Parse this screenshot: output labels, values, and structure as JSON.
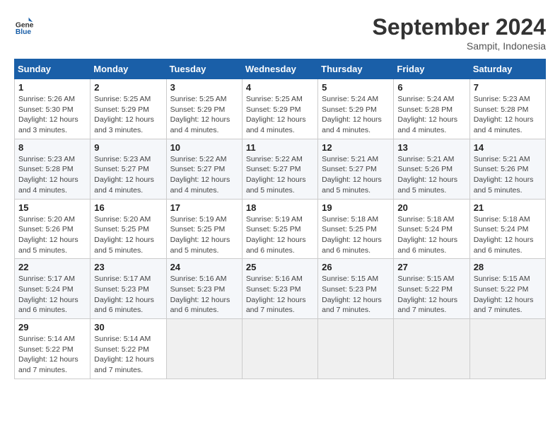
{
  "header": {
    "logo_general": "General",
    "logo_blue": "Blue",
    "month_title": "September 2024",
    "location": "Sampit, Indonesia"
  },
  "weekdays": [
    "Sunday",
    "Monday",
    "Tuesday",
    "Wednesday",
    "Thursday",
    "Friday",
    "Saturday"
  ],
  "days": [
    {
      "date": "",
      "sunrise": "",
      "sunset": "",
      "daylight": ""
    },
    {
      "date": "1",
      "sunrise": "Sunrise: 5:26 AM",
      "sunset": "Sunset: 5:30 PM",
      "daylight": "Daylight: 12 hours and 3 minutes."
    },
    {
      "date": "2",
      "sunrise": "Sunrise: 5:25 AM",
      "sunset": "Sunset: 5:29 PM",
      "daylight": "Daylight: 12 hours and 3 minutes."
    },
    {
      "date": "3",
      "sunrise": "Sunrise: 5:25 AM",
      "sunset": "Sunset: 5:29 PM",
      "daylight": "Daylight: 12 hours and 4 minutes."
    },
    {
      "date": "4",
      "sunrise": "Sunrise: 5:25 AM",
      "sunset": "Sunset: 5:29 PM",
      "daylight": "Daylight: 12 hours and 4 minutes."
    },
    {
      "date": "5",
      "sunrise": "Sunrise: 5:24 AM",
      "sunset": "Sunset: 5:29 PM",
      "daylight": "Daylight: 12 hours and 4 minutes."
    },
    {
      "date": "6",
      "sunrise": "Sunrise: 5:24 AM",
      "sunset": "Sunset: 5:28 PM",
      "daylight": "Daylight: 12 hours and 4 minutes."
    },
    {
      "date": "7",
      "sunrise": "Sunrise: 5:23 AM",
      "sunset": "Sunset: 5:28 PM",
      "daylight": "Daylight: 12 hours and 4 minutes."
    },
    {
      "date": "8",
      "sunrise": "Sunrise: 5:23 AM",
      "sunset": "Sunset: 5:28 PM",
      "daylight": "Daylight: 12 hours and 4 minutes."
    },
    {
      "date": "9",
      "sunrise": "Sunrise: 5:23 AM",
      "sunset": "Sunset: 5:27 PM",
      "daylight": "Daylight: 12 hours and 4 minutes."
    },
    {
      "date": "10",
      "sunrise": "Sunrise: 5:22 AM",
      "sunset": "Sunset: 5:27 PM",
      "daylight": "Daylight: 12 hours and 4 minutes."
    },
    {
      "date": "11",
      "sunrise": "Sunrise: 5:22 AM",
      "sunset": "Sunset: 5:27 PM",
      "daylight": "Daylight: 12 hours and 5 minutes."
    },
    {
      "date": "12",
      "sunrise": "Sunrise: 5:21 AM",
      "sunset": "Sunset: 5:27 PM",
      "daylight": "Daylight: 12 hours and 5 minutes."
    },
    {
      "date": "13",
      "sunrise": "Sunrise: 5:21 AM",
      "sunset": "Sunset: 5:26 PM",
      "daylight": "Daylight: 12 hours and 5 minutes."
    },
    {
      "date": "14",
      "sunrise": "Sunrise: 5:21 AM",
      "sunset": "Sunset: 5:26 PM",
      "daylight": "Daylight: 12 hours and 5 minutes."
    },
    {
      "date": "15",
      "sunrise": "Sunrise: 5:20 AM",
      "sunset": "Sunset: 5:26 PM",
      "daylight": "Daylight: 12 hours and 5 minutes."
    },
    {
      "date": "16",
      "sunrise": "Sunrise: 5:20 AM",
      "sunset": "Sunset: 5:25 PM",
      "daylight": "Daylight: 12 hours and 5 minutes."
    },
    {
      "date": "17",
      "sunrise": "Sunrise: 5:19 AM",
      "sunset": "Sunset: 5:25 PM",
      "daylight": "Daylight: 12 hours and 5 minutes."
    },
    {
      "date": "18",
      "sunrise": "Sunrise: 5:19 AM",
      "sunset": "Sunset: 5:25 PM",
      "daylight": "Daylight: 12 hours and 6 minutes."
    },
    {
      "date": "19",
      "sunrise": "Sunrise: 5:18 AM",
      "sunset": "Sunset: 5:25 PM",
      "daylight": "Daylight: 12 hours and 6 minutes."
    },
    {
      "date": "20",
      "sunrise": "Sunrise: 5:18 AM",
      "sunset": "Sunset: 5:24 PM",
      "daylight": "Daylight: 12 hours and 6 minutes."
    },
    {
      "date": "21",
      "sunrise": "Sunrise: 5:18 AM",
      "sunset": "Sunset: 5:24 PM",
      "daylight": "Daylight: 12 hours and 6 minutes."
    },
    {
      "date": "22",
      "sunrise": "Sunrise: 5:17 AM",
      "sunset": "Sunset: 5:24 PM",
      "daylight": "Daylight: 12 hours and 6 minutes."
    },
    {
      "date": "23",
      "sunrise": "Sunrise: 5:17 AM",
      "sunset": "Sunset: 5:23 PM",
      "daylight": "Daylight: 12 hours and 6 minutes."
    },
    {
      "date": "24",
      "sunrise": "Sunrise: 5:16 AM",
      "sunset": "Sunset: 5:23 PM",
      "daylight": "Daylight: 12 hours and 6 minutes."
    },
    {
      "date": "25",
      "sunrise": "Sunrise: 5:16 AM",
      "sunset": "Sunset: 5:23 PM",
      "daylight": "Daylight: 12 hours and 7 minutes."
    },
    {
      "date": "26",
      "sunrise": "Sunrise: 5:15 AM",
      "sunset": "Sunset: 5:23 PM",
      "daylight": "Daylight: 12 hours and 7 minutes."
    },
    {
      "date": "27",
      "sunrise": "Sunrise: 5:15 AM",
      "sunset": "Sunset: 5:22 PM",
      "daylight": "Daylight: 12 hours and 7 minutes."
    },
    {
      "date": "28",
      "sunrise": "Sunrise: 5:15 AM",
      "sunset": "Sunset: 5:22 PM",
      "daylight": "Daylight: 12 hours and 7 minutes."
    },
    {
      "date": "29",
      "sunrise": "Sunrise: 5:14 AM",
      "sunset": "Sunset: 5:22 PM",
      "daylight": "Daylight: 12 hours and 7 minutes."
    },
    {
      "date": "30",
      "sunrise": "Sunrise: 5:14 AM",
      "sunset": "Sunset: 5:22 PM",
      "daylight": "Daylight: 12 hours and 7 minutes."
    }
  ]
}
